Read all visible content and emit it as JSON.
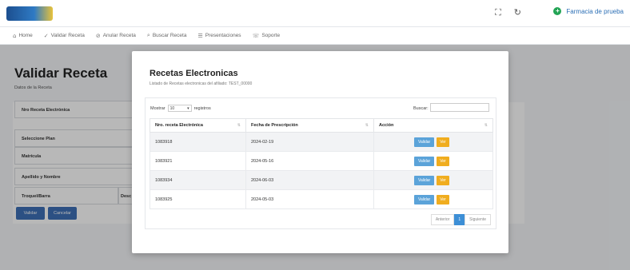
{
  "topbar": {
    "user_name": "Farmacia de prueba",
    "icons": [
      "expand-icon",
      "refresh-icon",
      "user-icon"
    ]
  },
  "menu": {
    "items": [
      {
        "icon": "home-icon",
        "label": "Home"
      },
      {
        "icon": "check-icon",
        "label": "Validar Receta"
      },
      {
        "icon": "pill-icon",
        "label": "Anular Receta"
      },
      {
        "icon": "search-icon",
        "label": "Buscar Receta"
      },
      {
        "icon": "list-icon",
        "label": "Presentaciones"
      },
      {
        "icon": "support-icon",
        "label": "Soporte"
      }
    ]
  },
  "page": {
    "title": "Validar Receta",
    "subtitle": "Datos de la Receta",
    "fields": [
      "Nro Receta Electrónica",
      "Seleccione Plan",
      "Matrícula",
      "Apellido y Nombre",
      "Troquel/Barra"
    ],
    "extra_label": "Desc",
    "buttons": [
      "Validar",
      "Cancelar"
    ]
  },
  "modal": {
    "title": "Recetas Electronicas",
    "subtitle": "Listado de Recetas electronicas del afiliado: TEST_00000",
    "show_label": "Mostrar",
    "show_value": "10",
    "show_suffix": "registros",
    "search_label": "Buscar:",
    "columns": [
      "Nro. receta Electrónica",
      "Fecha de Prescripción",
      "Acción"
    ],
    "rows": [
      {
        "nro": "1083918",
        "fecha": "2024-02-19"
      },
      {
        "nro": "1083921",
        "fecha": "2024-05-16"
      },
      {
        "nro": "1083934",
        "fecha": "2024-06-03"
      },
      {
        "nro": "1083925",
        "fecha": "2024-05-03"
      }
    ],
    "action_validar": "Validar",
    "action_ver": "Ver",
    "pager": {
      "prev": "Anterior",
      "current": "1",
      "next": "Siguiente"
    }
  },
  "colors": {
    "accent": "#3d6fb6",
    "validar": "#5ba3d9",
    "ver": "#f0ad1f",
    "user_status": "#23a455"
  }
}
